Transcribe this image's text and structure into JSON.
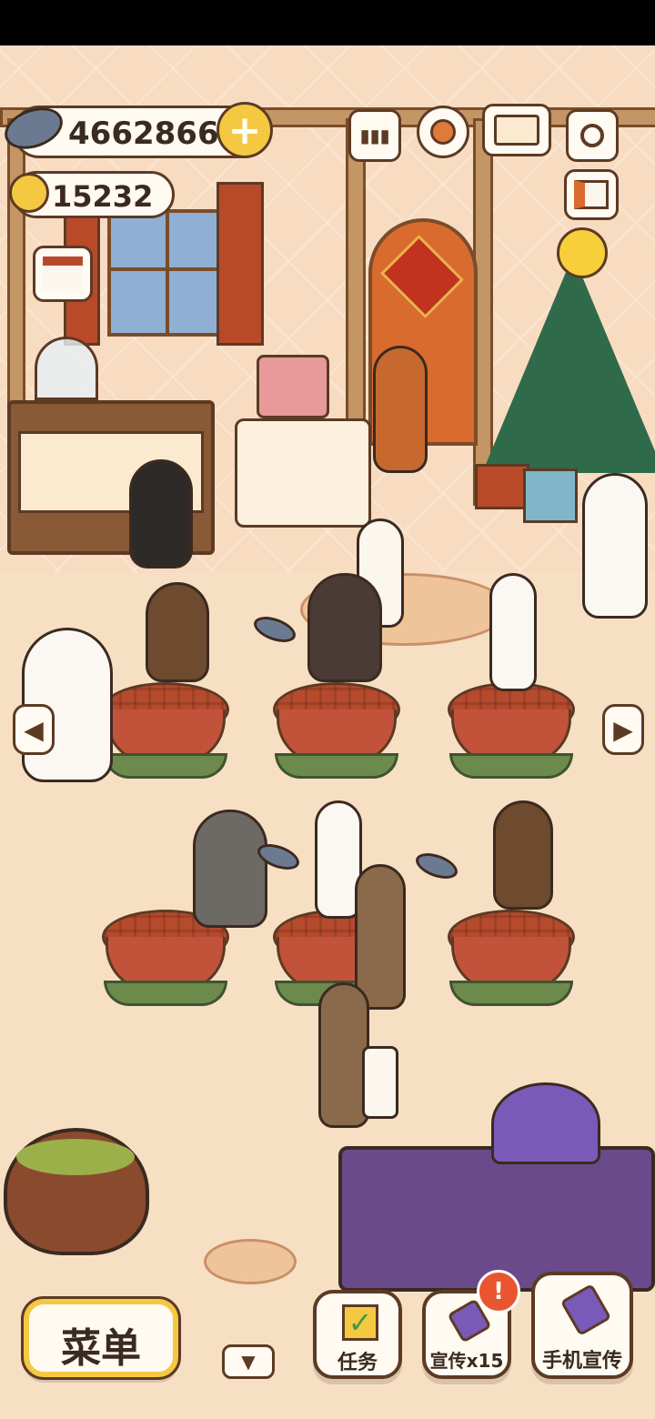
{
  "hud": {
    "fish_coins": "4662866",
    "stars": "15232"
  },
  "bottom_bar": {
    "menu_label": "菜单",
    "task_label": "任务",
    "promote_label": "宣传x15",
    "phone_promote_label": "手机宣传",
    "alert_badge": "!"
  },
  "colors": {
    "accent": "#f5c842",
    "outline": "#5c3a24",
    "alert": "#e8552e"
  }
}
